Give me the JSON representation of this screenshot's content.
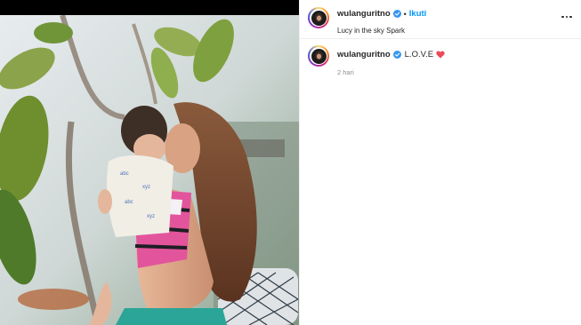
{
  "post": {
    "username": "wulanguritno",
    "verified": true,
    "separator": "•",
    "follow_label": "Ikuti",
    "location": "Lucy in the sky Spark",
    "more_icon": "more-horizontal-icon"
  },
  "caption": {
    "username": "wulanguritno",
    "text": "L.O.V.E",
    "emoji": "red-heart-icon",
    "timestamp": "2 hari"
  },
  "colors": {
    "accent": "#0095f6",
    "text": "#262626",
    "muted": "#8e8e8e",
    "heart": "#ed4956",
    "divider": "#efefef"
  }
}
